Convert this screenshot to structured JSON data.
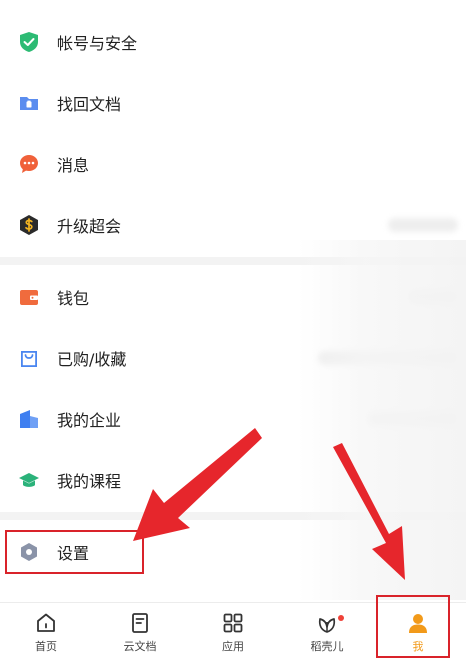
{
  "menu": {
    "account_security": "帐号与安全",
    "recover_docs": "找回文档",
    "messages": "消息",
    "upgrade_super": "升级超会",
    "wallet": "钱包",
    "purchased_favorites": "已购/收藏",
    "my_enterprise": "我的企业",
    "my_courses": "我的课程",
    "settings": "设置"
  },
  "tabs": {
    "home": "首页",
    "cloud_docs": "云文档",
    "apps": "应用",
    "daoke": "稻壳儿",
    "me": "我"
  },
  "colors": {
    "accent_orange": "#f29a1a",
    "annotation_red": "#d9232a",
    "shield_green": "#2dbb74",
    "folder_blue": "#5b8def",
    "message_red": "#f0613a",
    "wallet_orange": "#f06b3d",
    "bag_blue": "#4a86f0",
    "enterprise_blue": "#3f7ff0",
    "course_green": "#2bb27a",
    "settings_gray": "#8a93a8"
  },
  "icons": [
    "shield-check-icon",
    "folder-icon",
    "chat-bubble-icon",
    "dollar-hexagon-icon",
    "wallet-icon",
    "shopping-bag-icon",
    "building-icon",
    "graduation-cap-icon",
    "hexagon-gear-icon",
    "home-icon",
    "document-icon",
    "grid-icon",
    "leaf-icon",
    "user-icon"
  ]
}
